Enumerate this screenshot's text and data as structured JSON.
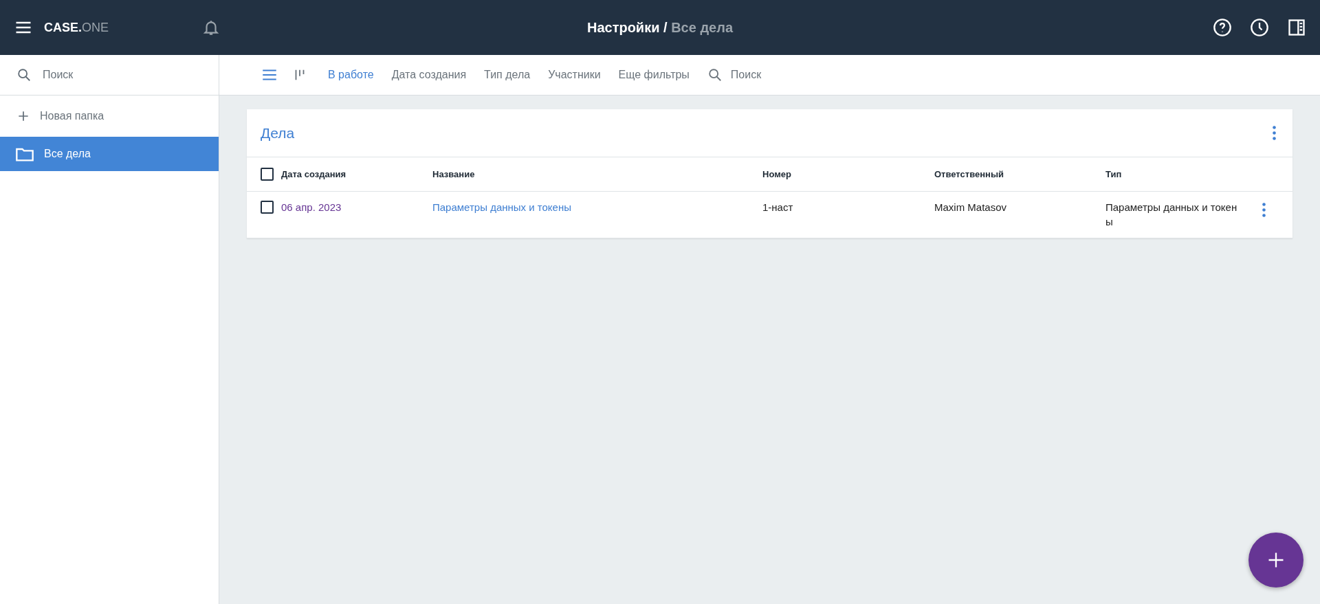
{
  "header": {
    "logo": {
      "bold": "CASE.",
      "light": "ONE"
    },
    "breadcrumb": {
      "current_section": "Настройки",
      "separator": " / ",
      "page": "Все дела"
    }
  },
  "sidebar": {
    "search": {
      "placeholder": "Поиск"
    },
    "new_folder": "Новая папка",
    "items": [
      {
        "label": "Все дела",
        "selected": true
      }
    ]
  },
  "toolbar": {
    "view_modes": [
      {
        "kind": "list",
        "selected": true
      },
      {
        "kind": "kanban",
        "selected": false
      }
    ],
    "filters": [
      {
        "label": "В работе",
        "selected": true
      },
      {
        "label": "Дата создания",
        "selected": false
      },
      {
        "label": "Тип дела",
        "selected": false
      },
      {
        "label": "Участники",
        "selected": false
      },
      {
        "label": "Еще фильтры",
        "selected": false
      }
    ],
    "search": {
      "placeholder": "Поиск"
    }
  },
  "card": {
    "title": "Дела",
    "table": {
      "columns": [
        "Дата создания",
        "Название",
        "Номер",
        "Ответственный",
        "Тип"
      ],
      "all_checked": false,
      "rows": [
        {
          "checked": false,
          "date": "06 апр. 2023",
          "name": "Параметры данных и токены",
          "number": "1-наст",
          "responsible": "Maxim Matasov",
          "type": "Параметры данных и токены"
        }
      ]
    }
  }
}
